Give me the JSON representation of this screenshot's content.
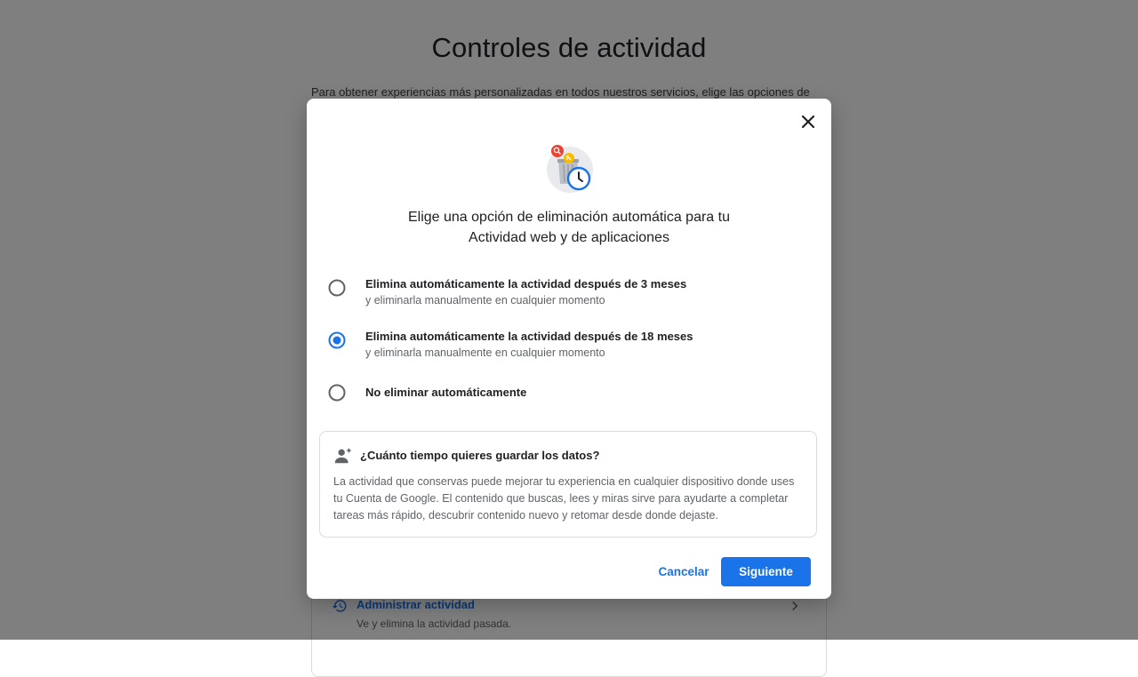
{
  "background": {
    "title": "Controles de actividad",
    "intro": "Para obtener experiencias más personalizadas en todos nuestros servicios, elige las opciones de",
    "manage": {
      "title": "Administrar actividad",
      "subtitle": "Ve y elimina la actividad pasada.",
      "icon": "history-icon"
    }
  },
  "dialog": {
    "heading_line1": "Elige una opción de eliminación automática para tu",
    "heading_line2": "Actividad web y de aplicaciones",
    "options": [
      {
        "title": "Elimina automáticamente la actividad después de 3 meses",
        "subtitle": "y eliminarla manualmente en cualquier momento",
        "selected": false
      },
      {
        "title": "Elimina automáticamente la actividad después de 18 meses",
        "subtitle": "y eliminarla manualmente en cualquier momento",
        "selected": true
      },
      {
        "title": "No eliminar automáticamente",
        "subtitle": "",
        "selected": false
      }
    ],
    "info": {
      "title": "¿Cuánto tiempo quieres guardar los datos?",
      "body": "La actividad que conservas puede mejorar tu experiencia en cualquier dispositivo donde uses tu Cuenta de Google. El contenido que buscas, lees y miras sirve para ayudarte a completar tareas más rápido, descubrir contenido nuevo y retomar desde donde dejaste."
    },
    "buttons": {
      "cancel": "Cancelar",
      "next": "Siguiente"
    }
  },
  "colors": {
    "accent": "#1a73e8",
    "scrim": "#000000"
  }
}
